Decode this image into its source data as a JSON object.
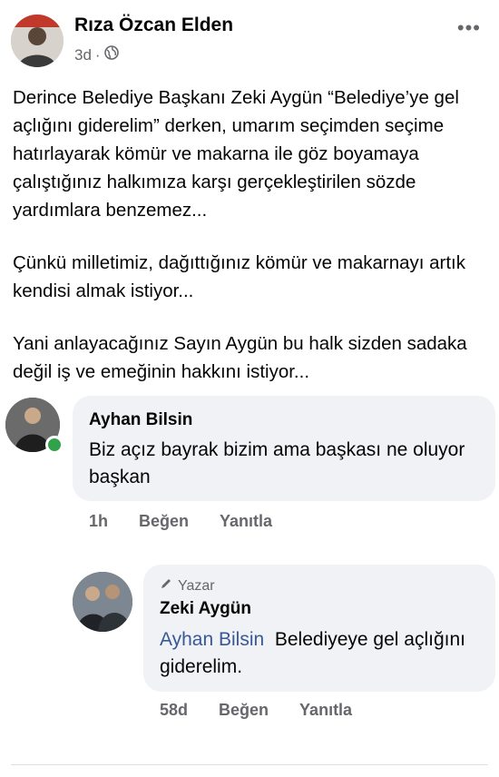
{
  "post": {
    "author": "Rıza Özcan Elden",
    "time": "3d",
    "separator": "·",
    "privacy_icon": "globe-icon",
    "more_label": "•••",
    "paragraphs": [
      "Derince Belediye Başkanı Zeki Aygün “Belediye’ye gel açlığını giderelim” derken, umarım seçimden seçime hatırlayarak kömür ve makarna ile göz boyamaya çalıştığınız halkımıza karşı gerçekleştirilen sözde yardımlara benzemez...",
      "Çünkü milletimiz, dağıttığınız kömür ve makarnayı artık kendisi almak istiyor...",
      "Yani anlayacağınız Sayın Aygün bu halk sizden sadaka değil iş ve emeğinin hakkını istiyor..."
    ]
  },
  "comments": [
    {
      "name": "Ayhan Bilsin",
      "text": "Biz açız bayrak bizim ama başkası ne oluyor başkan",
      "time": "1h",
      "like_label": "Beğen",
      "reply_label": "Yanıtla",
      "online_color": "#31a24c"
    },
    {
      "badge": "Yazar",
      "badge_icon": "pencil-icon",
      "name": "Zeki Aygün",
      "mention": "Ayhan Bilsin",
      "text": "Belediyeye gel açlığını giderelim.",
      "time": "58d",
      "like_label": "Beğen",
      "reply_label": "Yanıtla"
    }
  ],
  "colors": {
    "text": "#050505",
    "secondary": "#65676b",
    "bubble": "#f0f2f5",
    "mention": "#385898"
  }
}
